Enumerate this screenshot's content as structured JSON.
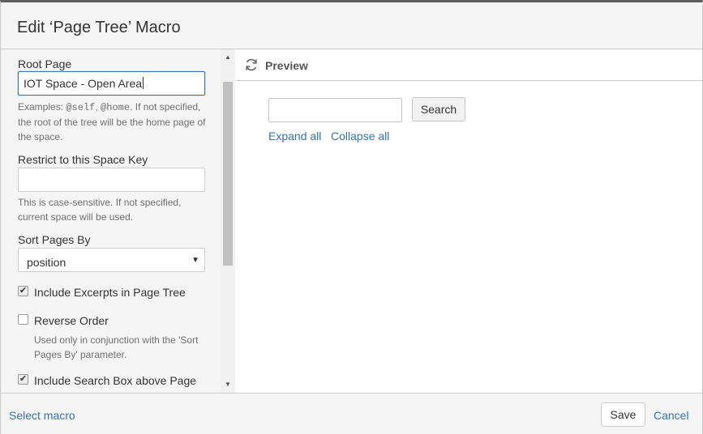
{
  "dialog": {
    "title": "Edit ‘Page Tree’ Macro"
  },
  "form": {
    "root_page": {
      "label": "Root Page",
      "value": "IOT Space - Open Area",
      "help_prefix": "Examples: ",
      "help_code1": "@self",
      "help_sep": ", ",
      "help_code2": "@home",
      "help_suffix": ". If not specified, the root of the tree will be the home page of the space."
    },
    "space_key": {
      "label": "Restrict to this Space Key",
      "value": "",
      "help": "This is case-sensitive. If not specified, current space will be used."
    },
    "sort": {
      "label": "Sort Pages By",
      "selected": "position"
    },
    "include_excerpts": {
      "label": "Include Excerpts in Page Tree",
      "checked": true
    },
    "reverse_order": {
      "label": "Reverse Order",
      "checked": false,
      "help": "Used only in conjunction with the 'Sort Pages By' parameter."
    },
    "include_search": {
      "label": "Include Search Box above Page",
      "checked": true
    }
  },
  "preview": {
    "label": "Preview",
    "search_button": "Search",
    "expand_all": "Expand all",
    "collapse_all": "Collapse all"
  },
  "footer": {
    "select_macro": "Select macro",
    "save": "Save",
    "cancel": "Cancel"
  },
  "icons": {
    "refresh": "refresh-icon",
    "checkmark": "✔",
    "dropdown": "▼"
  },
  "colors": {
    "link": "#3572b0",
    "panel_bg": "#f5f5f5",
    "focus_border": "#3b73af"
  }
}
